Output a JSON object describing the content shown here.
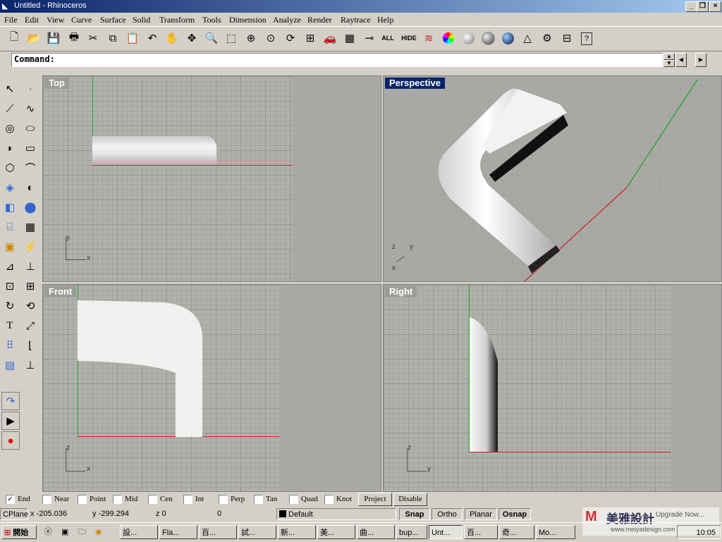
{
  "window": {
    "title": "Untitled - Rhinoceros"
  },
  "menu": [
    "File",
    "Edit",
    "View",
    "Curve",
    "Surface",
    "Solid",
    "Transform",
    "Tools",
    "Dimension",
    "Analyze",
    "Render",
    "Raytrace",
    "Help"
  ],
  "toolbar": {
    "all_label": "ALL",
    "hide_label": "HIDE"
  },
  "command": {
    "label": "Command:",
    "value": ""
  },
  "viewports": {
    "top": "Top",
    "perspective": "Perspective",
    "front": "Front",
    "right": "Right"
  },
  "axes": {
    "x": "x",
    "y": "y",
    "z": "z"
  },
  "osnap": {
    "items": [
      {
        "label": "End",
        "checked": true
      },
      {
        "label": "Near",
        "checked": false
      },
      {
        "label": "Point",
        "checked": false
      },
      {
        "label": "Mid",
        "checked": false
      },
      {
        "label": "Cen",
        "checked": false
      },
      {
        "label": "Int",
        "checked": false
      },
      {
        "label": "Perp",
        "checked": false
      },
      {
        "label": "Tan",
        "checked": false
      },
      {
        "label": "Quad",
        "checked": false
      },
      {
        "label": "Knot",
        "checked": false
      }
    ],
    "project": "Project",
    "disable": "Disable"
  },
  "status": {
    "cplane": "CPlane",
    "x": "x -205.036",
    "y": "y -299.294",
    "z": "z 0",
    "extra": "0",
    "layer": "Default",
    "snap": "Snap",
    "ortho": "Ortho",
    "planar": "Planar",
    "osnap": "Osnap",
    "watermark": "美雅設計",
    "watermark_url": "www.meiyadesign.com",
    "upgrade": "Upgrade Now..."
  },
  "taskbar": {
    "start": "開始",
    "tasks": [
      "設...",
      "Fla...",
      "百...",
      "試...",
      "新...",
      "美...",
      "曲...",
      "bup...",
      "Unt...",
      "百...",
      "奇...",
      "Mo..."
    ],
    "clock": "10:05"
  },
  "colors": {
    "title_start": "#0a246a",
    "title_end": "#a6caf0",
    "x_axis": "#cc2a2a",
    "y_axis": "#2aa02a",
    "viewport_bg": "#a8a9a4"
  }
}
